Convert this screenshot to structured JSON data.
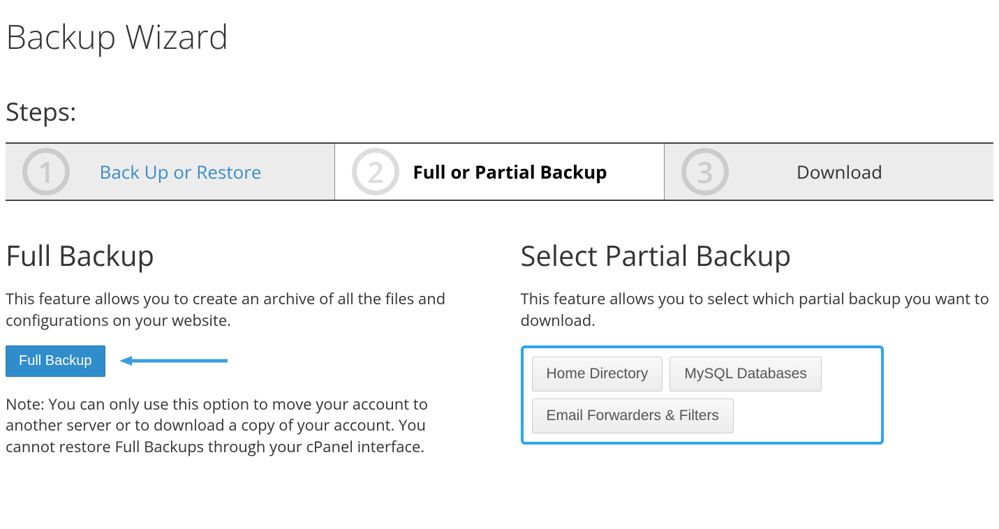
{
  "page_title": "Backup Wizard",
  "steps_title": "Steps:",
  "steps": [
    {
      "number": "1",
      "label": "Back Up or Restore"
    },
    {
      "number": "2",
      "label": "Full or Partial Backup"
    },
    {
      "number": "3",
      "label": "Download"
    }
  ],
  "full_backup": {
    "title": "Full Backup",
    "description": "This feature allows you to create an archive of all the files and configurations on your website.",
    "button_label": "Full Backup",
    "note": "Note: You can only use this option to move your account to another server or to download a copy of your account. You cannot restore Full Backups through your cPanel interface."
  },
  "partial_backup": {
    "title": "Select Partial Backup",
    "description": "This feature allows you to select which partial backup you want to download.",
    "buttons": [
      "Home Directory",
      "MySQL Databases",
      "Email Forwarders & Filters"
    ]
  }
}
